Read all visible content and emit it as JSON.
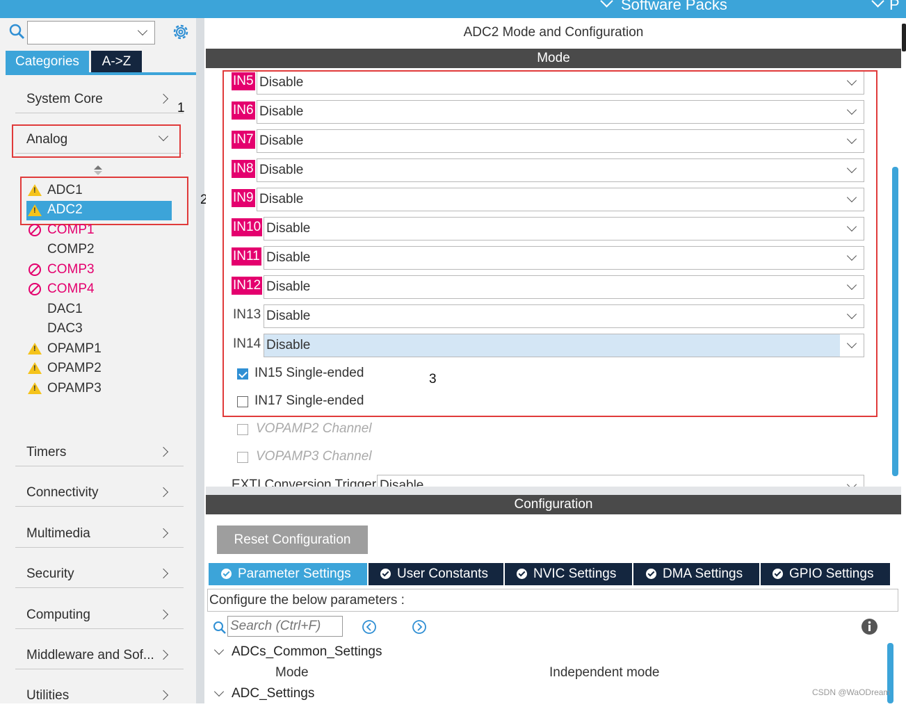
{
  "topbar": {
    "software_packs": "Software Packs",
    "cut_label": "P"
  },
  "left": {
    "search_placeholder": "",
    "tabs": [
      {
        "label": "Categories"
      },
      {
        "label": "A->Z"
      }
    ],
    "categories_top": [
      {
        "label": "System Core"
      },
      {
        "label": "Analog"
      }
    ],
    "analog_items": [
      {
        "label": "ADC1",
        "status": "warning"
      },
      {
        "label": "ADC2",
        "status": "warning",
        "selected": true
      },
      {
        "label": "COMP1",
        "status": "unavailable"
      },
      {
        "label": "COMP2",
        "status": "none"
      },
      {
        "label": "COMP3",
        "status": "unavailable"
      },
      {
        "label": "COMP4",
        "status": "unavailable"
      },
      {
        "label": "DAC1",
        "status": "none"
      },
      {
        "label": "DAC3",
        "status": "none"
      },
      {
        "label": "OPAMP1",
        "status": "warning"
      },
      {
        "label": "OPAMP2",
        "status": "warning"
      },
      {
        "label": "OPAMP3",
        "status": "warning"
      }
    ],
    "categories_bottom": [
      {
        "label": "Timers"
      },
      {
        "label": "Connectivity"
      },
      {
        "label": "Multimedia"
      },
      {
        "label": "Security"
      },
      {
        "label": "Computing"
      },
      {
        "label": "Middleware and Sof..."
      },
      {
        "label": "Utilities"
      }
    ]
  },
  "annotations": {
    "n1": "1",
    "n2": "2",
    "n3": "3"
  },
  "main": {
    "title": "ADC2 Mode and Configuration",
    "mode_header": "Mode",
    "inputs": [
      {
        "tag": "IN5",
        "value": "Disable",
        "highlight": true
      },
      {
        "tag": "IN6",
        "value": "Disable",
        "highlight": true
      },
      {
        "tag": "IN7",
        "value": "Disable",
        "highlight": true
      },
      {
        "tag": "IN8",
        "value": "Disable",
        "highlight": true
      },
      {
        "tag": "IN9",
        "value": "Disable",
        "highlight": true
      },
      {
        "tag": "IN10",
        "value": "Disable",
        "highlight": true
      },
      {
        "tag": "IN11",
        "value": "Disable",
        "highlight": true
      },
      {
        "tag": "IN12",
        "value": "Disable",
        "highlight": true
      },
      {
        "tag": "IN13",
        "value": "Disable",
        "highlight": false
      },
      {
        "tag": "IN14",
        "value": "Disable",
        "highlight": false,
        "focused": true
      }
    ],
    "checkboxes": [
      {
        "label": "IN15 Single-ended",
        "checked": true,
        "disabled": false
      },
      {
        "label": "IN17 Single-ended",
        "checked": false,
        "disabled": false
      },
      {
        "label": "VOPAMP2 Channel",
        "checked": false,
        "disabled": true
      },
      {
        "label": "VOPAMP3 Channel",
        "checked": false,
        "disabled": true
      }
    ],
    "exti": {
      "label": "EXTI Conversion Trigger",
      "value": "Disable"
    },
    "config_header": "Configuration",
    "reset_button": "Reset Configuration",
    "tabs": [
      {
        "label": "Parameter Settings"
      },
      {
        "label": "User Constants"
      },
      {
        "label": "NVIC Settings"
      },
      {
        "label": "DMA Settings"
      },
      {
        "label": "GPIO Settings"
      }
    ],
    "configure_text": "Configure the below parameters :",
    "search_placeholder": "Search (Ctrl+F)",
    "tree": {
      "group1": "ADCs_Common_Settings",
      "mode_label": "Mode",
      "mode_value": "Independent mode",
      "group2": "ADC_Settings"
    }
  },
  "watermark": "CSDN @WaODream",
  "colors": {
    "accent": "#3ca4d9",
    "pin_highlight": "#e4006e",
    "annotation_box": "#e03a3a",
    "dark_bar": "#4a4a4a",
    "tab_dark": "#14263f"
  }
}
